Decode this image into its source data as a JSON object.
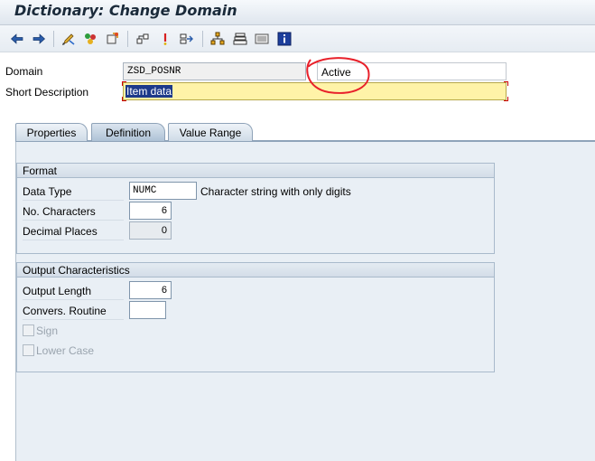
{
  "window": {
    "title": "Dictionary: Change Domain"
  },
  "toolbar": {
    "buttons": [
      {
        "icon": "back-arrow-icon"
      },
      {
        "icon": "forward-arrow-icon"
      },
      {
        "icon": "display-change-icon"
      },
      {
        "icon": "check-object-icon"
      },
      {
        "icon": "activate-icon"
      },
      {
        "icon": "other-object-icon"
      },
      {
        "icon": "where-used-icon"
      },
      {
        "icon": "navigate-icon"
      },
      {
        "icon": "hierarchy-icon"
      },
      {
        "icon": "stack-icon"
      },
      {
        "icon": "list-icon"
      },
      {
        "icon": "info-icon"
      }
    ]
  },
  "header": {
    "domain_label": "Domain",
    "domain_value": "ZSD_POSNR",
    "status": "Active",
    "short_desc_label": "Short Description",
    "short_desc_value": "Item data"
  },
  "tabs": [
    {
      "label": "Properties",
      "active": false
    },
    {
      "label": "Definition",
      "active": true
    },
    {
      "label": "Value Range",
      "active": false
    }
  ],
  "format": {
    "title": "Format",
    "data_type_label": "Data Type",
    "data_type_value": "NUMC",
    "data_type_desc": "Character string with only digits",
    "no_chars_label": "No. Characters",
    "no_chars_value": "6",
    "decimal_label": "Decimal Places",
    "decimal_value": "0"
  },
  "output": {
    "title": "Output Characteristics",
    "output_length_label": "Output Length",
    "output_length_value": "6",
    "conv_routine_label": "Convers. Routine",
    "conv_routine_value": "",
    "sign_label": "Sign",
    "lowercase_label": "Lower Case"
  },
  "colors": {
    "annotation": "#e8202a",
    "highlight": "#fff3a8",
    "selection": "#1d3a8a"
  }
}
